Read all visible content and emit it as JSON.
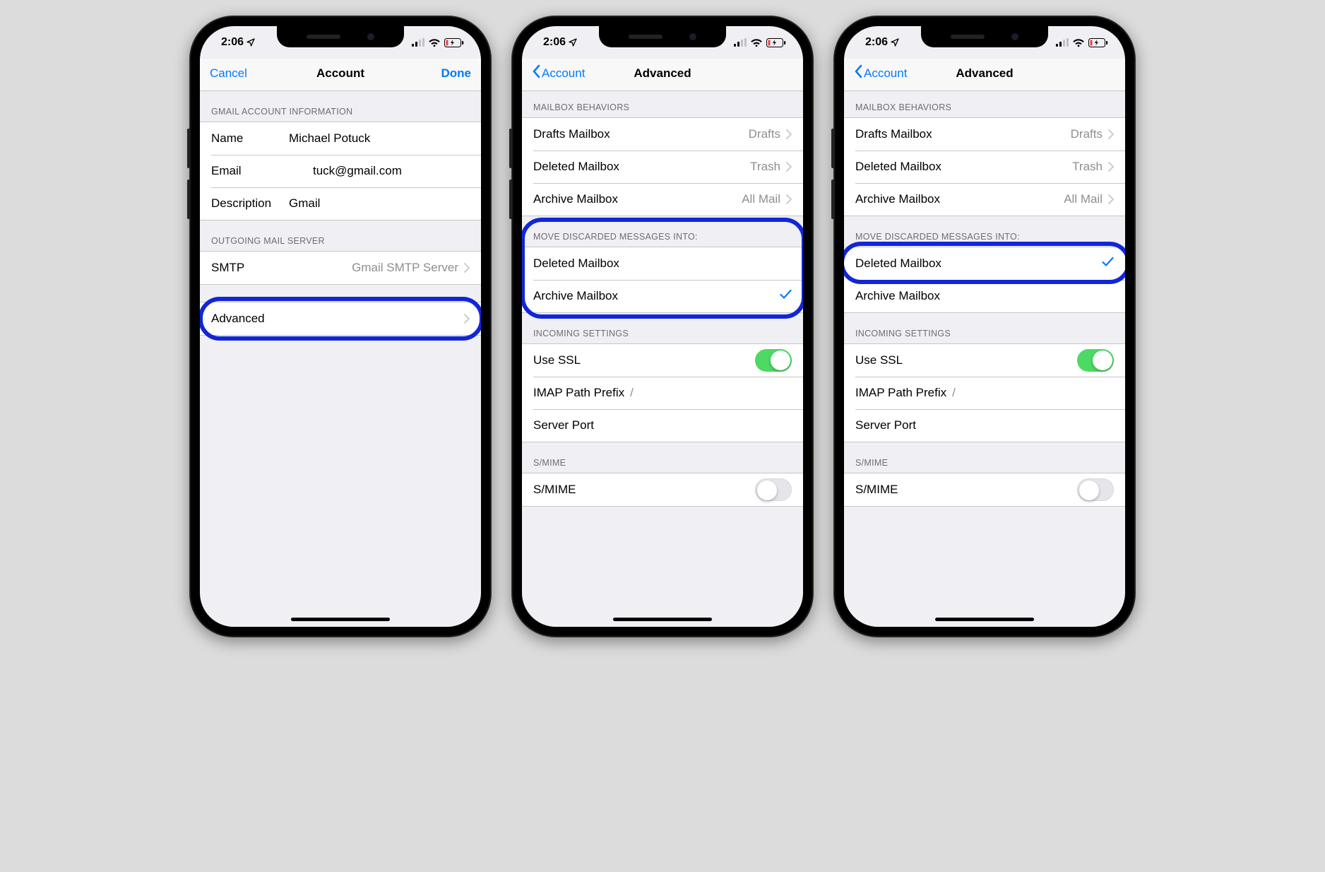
{
  "status": {
    "time": "2:06"
  },
  "phone1": {
    "nav": {
      "left": "Cancel",
      "title": "Account",
      "right": "Done"
    },
    "section1_header": "GMAIL ACCOUNT INFORMATION",
    "name_label": "Name",
    "name_value": "Michael Potuck",
    "email_label": "Email",
    "email_value": "tuck@gmail.com",
    "desc_label": "Description",
    "desc_value": "Gmail",
    "section2_header": "OUTGOING MAIL SERVER",
    "smtp_label": "SMTP",
    "smtp_value": "Gmail SMTP Server",
    "advanced_label": "Advanced"
  },
  "phone2": {
    "nav": {
      "back": "Account",
      "title": "Advanced"
    },
    "sec_behaviors": "MAILBOX BEHAVIORS",
    "drafts_label": "Drafts Mailbox",
    "drafts_value": "Drafts",
    "deleted_label": "Deleted Mailbox",
    "deleted_value": "Trash",
    "archive_label": "Archive Mailbox",
    "archive_value": "All Mail",
    "sec_move": "MOVE DISCARDED MESSAGES INTO:",
    "opt_deleted": "Deleted Mailbox",
    "opt_archive": "Archive Mailbox",
    "selected": "archive",
    "sec_incoming": "INCOMING SETTINGS",
    "use_ssl_label": "Use SSL",
    "use_ssl_on": true,
    "imap_prefix_label": "IMAP Path Prefix",
    "imap_prefix_value": "/",
    "server_port_label": "Server Port",
    "sec_smime": "S/MIME",
    "smime_label": "S/MIME",
    "smime_on": false
  },
  "phone3": {
    "nav": {
      "back": "Account",
      "title": "Advanced"
    },
    "sec_behaviors": "MAILBOX BEHAVIORS",
    "drafts_label": "Drafts Mailbox",
    "drafts_value": "Drafts",
    "deleted_label": "Deleted Mailbox",
    "deleted_value": "Trash",
    "archive_label": "Archive Mailbox",
    "archive_value": "All Mail",
    "sec_move": "MOVE DISCARDED MESSAGES INTO:",
    "opt_deleted": "Deleted Mailbox",
    "opt_archive": "Archive Mailbox",
    "selected": "deleted",
    "sec_incoming": "INCOMING SETTINGS",
    "use_ssl_label": "Use SSL",
    "use_ssl_on": true,
    "imap_prefix_label": "IMAP Path Prefix",
    "imap_prefix_value": "/",
    "server_port_label": "Server Port",
    "sec_smime": "S/MIME",
    "smime_label": "S/MIME",
    "smime_on": false
  }
}
